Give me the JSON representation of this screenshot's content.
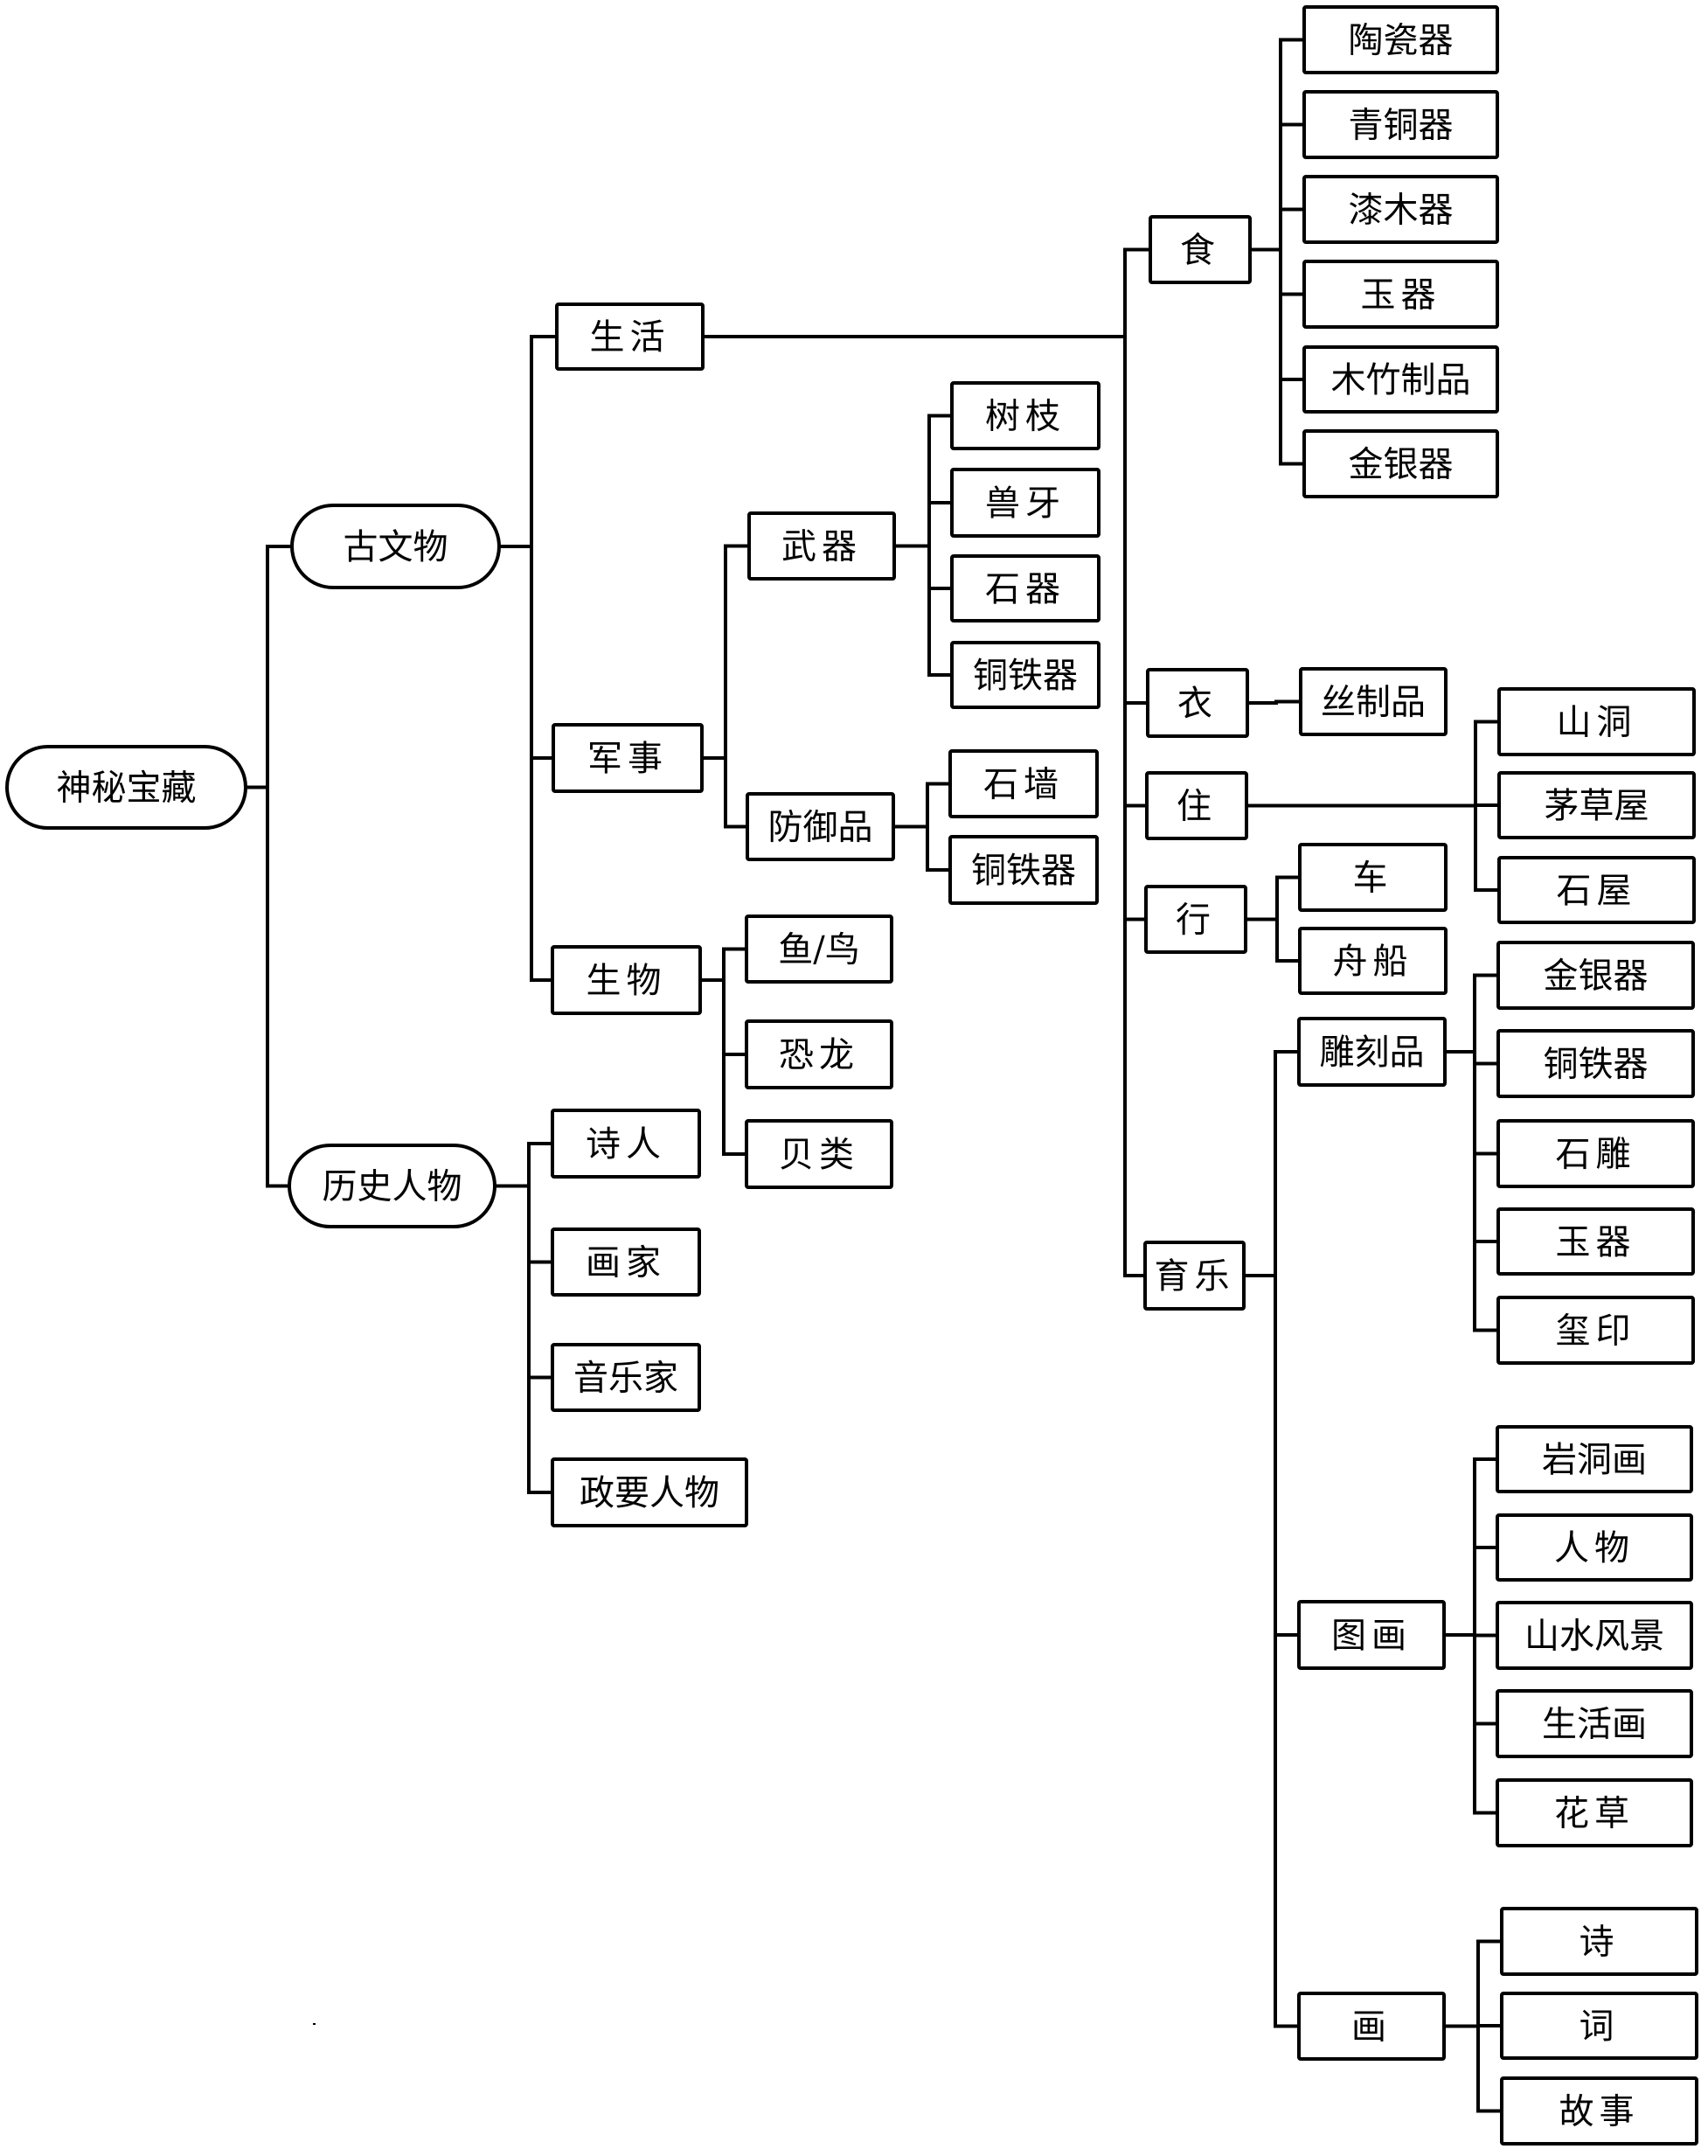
{
  "diagram": {
    "type": "tree",
    "root": {
      "id": "root",
      "label": "神秘宝藏",
      "shape": "rounded",
      "children": [
        {
          "id": "relics",
          "label": "古文物",
          "shape": "rounded",
          "children": [
            {
              "id": "life",
              "label": "生活",
              "shape": "rect",
              "children": [
                {
                  "id": "food",
                  "label": "食",
                  "shape": "rect",
                  "children": [
                    {
                      "id": "food-1",
                      "label": "陶瓷器",
                      "shape": "rect"
                    },
                    {
                      "id": "food-2",
                      "label": "青铜器",
                      "shape": "rect"
                    },
                    {
                      "id": "food-3",
                      "label": "漆木器",
                      "shape": "rect"
                    },
                    {
                      "id": "food-4",
                      "label": "玉器",
                      "shape": "rect"
                    },
                    {
                      "id": "food-5",
                      "label": "木竹制品",
                      "shape": "rect"
                    },
                    {
                      "id": "food-6",
                      "label": "金银器",
                      "shape": "rect"
                    }
                  ]
                },
                {
                  "id": "clothing",
                  "label": "衣",
                  "shape": "rect",
                  "children": [
                    {
                      "id": "clothing-1",
                      "label": "丝制品",
                      "shape": "rect"
                    }
                  ]
                },
                {
                  "id": "housing",
                  "label": "住",
                  "shape": "rect",
                  "children": [
                    {
                      "id": "housing-1",
                      "label": "山洞",
                      "shape": "rect"
                    },
                    {
                      "id": "housing-2",
                      "label": "茅草屋",
                      "shape": "rect"
                    },
                    {
                      "id": "housing-3",
                      "label": "石屋",
                      "shape": "rect"
                    }
                  ]
                },
                {
                  "id": "travel",
                  "label": "行",
                  "shape": "rect",
                  "children": [
                    {
                      "id": "travel-1",
                      "label": "车",
                      "shape": "rect"
                    },
                    {
                      "id": "travel-2",
                      "label": "舟船",
                      "shape": "rect"
                    }
                  ]
                },
                {
                  "id": "recreation",
                  "label": "育乐",
                  "shape": "rect",
                  "children": [
                    {
                      "id": "carving",
                      "label": "雕刻品",
                      "shape": "rect",
                      "children": [
                        {
                          "id": "carving-1",
                          "label": "金银器",
                          "shape": "rect"
                        },
                        {
                          "id": "carving-2",
                          "label": "铜铁器",
                          "shape": "rect"
                        },
                        {
                          "id": "carving-3",
                          "label": "石雕",
                          "shape": "rect"
                        },
                        {
                          "id": "carving-4",
                          "label": "玉器",
                          "shape": "rect"
                        },
                        {
                          "id": "carving-5",
                          "label": "玺印",
                          "shape": "rect"
                        }
                      ]
                    },
                    {
                      "id": "painting",
                      "label": "图画",
                      "shape": "rect",
                      "children": [
                        {
                          "id": "painting-1",
                          "label": "岩洞画",
                          "shape": "rect"
                        },
                        {
                          "id": "painting-2",
                          "label": "人物",
                          "shape": "rect"
                        },
                        {
                          "id": "painting-3",
                          "label": "山水风景",
                          "shape": "rect"
                        },
                        {
                          "id": "painting-4",
                          "label": "生活画",
                          "shape": "rect"
                        },
                        {
                          "id": "painting-5",
                          "label": "花草",
                          "shape": "rect"
                        }
                      ]
                    },
                    {
                      "id": "drawing",
                      "label": "画",
                      "shape": "rect",
                      "children": [
                        {
                          "id": "drawing-1",
                          "label": "诗",
                          "shape": "rect"
                        },
                        {
                          "id": "drawing-2",
                          "label": "词",
                          "shape": "rect"
                        },
                        {
                          "id": "drawing-3",
                          "label": "故事",
                          "shape": "rect"
                        }
                      ]
                    }
                  ]
                }
              ]
            },
            {
              "id": "military",
              "label": "军事",
              "shape": "rect",
              "children": [
                {
                  "id": "weapons",
                  "label": "武器",
                  "shape": "rect",
                  "children": [
                    {
                      "id": "weapons-1",
                      "label": "树枝",
                      "shape": "rect"
                    },
                    {
                      "id": "weapons-2",
                      "label": "兽牙",
                      "shape": "rect"
                    },
                    {
                      "id": "weapons-3",
                      "label": "石器",
                      "shape": "rect"
                    },
                    {
                      "id": "weapons-4",
                      "label": "铜铁器",
                      "shape": "rect"
                    }
                  ]
                },
                {
                  "id": "defense",
                  "label": "防御品",
                  "shape": "rect",
                  "children": [
                    {
                      "id": "defense-1",
                      "label": "石墙",
                      "shape": "rect"
                    },
                    {
                      "id": "defense-2",
                      "label": "铜铁器",
                      "shape": "rect"
                    }
                  ]
                }
              ]
            },
            {
              "id": "creatures",
              "label": "生物",
              "shape": "rect",
              "children": [
                {
                  "id": "creatures-1",
                  "label": "鱼/鸟",
                  "shape": "rect"
                },
                {
                  "id": "creatures-2",
                  "label": "恐龙",
                  "shape": "rect"
                },
                {
                  "id": "creatures-3",
                  "label": "贝类",
                  "shape": "rect"
                }
              ]
            }
          ]
        },
        {
          "id": "figures",
          "label": "历史人物",
          "shape": "rounded",
          "children": [
            {
              "id": "figures-1",
              "label": "诗人",
              "shape": "rect"
            },
            {
              "id": "figures-2",
              "label": "画家",
              "shape": "rect"
            },
            {
              "id": "figures-3",
              "label": "音乐家",
              "shape": "rect"
            },
            {
              "id": "figures-4",
              "label": "政要人物",
              "shape": "rect"
            }
          ]
        }
      ]
    }
  }
}
